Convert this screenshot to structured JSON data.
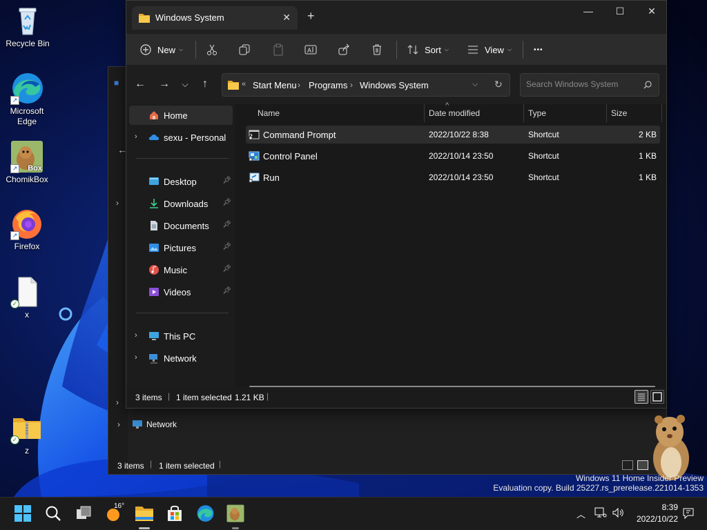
{
  "desktop": {
    "icons": [
      {
        "label": "Recycle Bin",
        "icon": "recycle-bin-icon"
      },
      {
        "label": "Microsoft\nEdge",
        "label_line1": "Microsoft",
        "label_line2": "Edge",
        "icon": "edge-icon"
      },
      {
        "label": "ChomikBox",
        "icon": "chomikbox-icon",
        "badge_text": "Box"
      },
      {
        "label": "Firefox",
        "icon": "firefox-icon"
      },
      {
        "label": "x",
        "icon": "blank-file-icon"
      },
      {
        "label": "z",
        "icon": "zip-folder-icon"
      }
    ]
  },
  "background_window": {
    "nav_item": "Network",
    "status": {
      "items": "3 items",
      "selected": "1 item selected"
    }
  },
  "window": {
    "tab_title": "Windows System",
    "new_tab": "+",
    "caption": {
      "minimize": "—",
      "maximize": "☐",
      "close": "✕"
    },
    "commandbar": {
      "new_label": "New",
      "sort_label": "Sort",
      "view_label": "View",
      "more_label": "•••"
    },
    "breadcrumb": {
      "overflow": "«",
      "items": [
        "Start Menu",
        "Programs",
        "Windows System"
      ]
    },
    "search": {
      "placeholder": "Search Windows System"
    },
    "nav": {
      "home": "Home",
      "onedrive": "sexu - Personal",
      "quick": [
        "Desktop",
        "Downloads",
        "Documents",
        "Pictures",
        "Music",
        "Videos"
      ],
      "this_pc": "This PC",
      "network": "Network"
    },
    "columns": {
      "name": "Name",
      "date": "Date modified",
      "type": "Type",
      "size": "Size"
    },
    "files": [
      {
        "name": "Command Prompt",
        "date": "2022/10/22 8:38",
        "type": "Shortcut",
        "size": "2 KB",
        "icon": "command-prompt-icon",
        "selected": true
      },
      {
        "name": "Control Panel",
        "date": "2022/10/14 23:50",
        "type": "Shortcut",
        "size": "1 KB",
        "icon": "control-panel-icon",
        "selected": false
      },
      {
        "name": "Run",
        "date": "2022/10/14 23:50",
        "type": "Shortcut",
        "size": "1 KB",
        "icon": "run-icon",
        "selected": false
      }
    ],
    "status": {
      "items": "3 items",
      "selected": "1 item selected",
      "size": "1.21 KB"
    }
  },
  "watermark": {
    "line1": "Windows 11 Home Insider Preview",
    "line2": "Evaluation copy. Build 25227.rs_prerelease.221014-1353"
  },
  "taskbar": {
    "weather_temp": "16°",
    "time": "8:39",
    "date": "2022/10/22"
  },
  "colors": {
    "accent": "#0078d4",
    "folder": "#f2c94c",
    "selection": "#2d2d2d"
  }
}
